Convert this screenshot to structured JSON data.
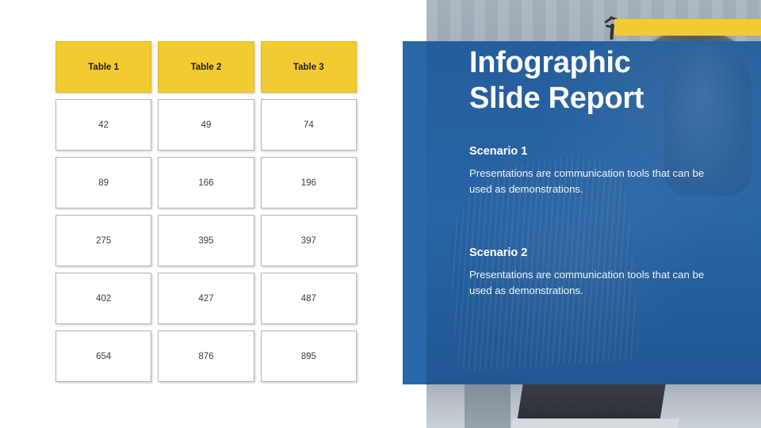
{
  "slide": {
    "background_color": "#ffffff",
    "accent_yellow": "#f2cb30",
    "panel_blue": "#2a67a8"
  },
  "panel": {
    "title": "Infographic\nSlide Report",
    "scenarios": [
      {
        "heading": "Scenario 1",
        "body": "Presentations are communication tools that can be used as demonstrations."
      },
      {
        "heading": "Scenario 2",
        "body": "Presentations are communication tools that can be used as demonstrations."
      }
    ]
  },
  "table": {
    "headers": [
      "Table 1",
      "Table 2",
      "Table 3"
    ],
    "rows": [
      [
        "42",
        "49",
        "74"
      ],
      [
        "89",
        "166",
        "196"
      ],
      [
        "275",
        "395",
        "397"
      ],
      [
        "402",
        "427",
        "487"
      ],
      [
        "654",
        "876",
        "895"
      ]
    ]
  },
  "chart_data": {
    "type": "table",
    "title": "Infographic Slide Report",
    "categories": [
      "Table 1",
      "Table 2",
      "Table 3"
    ],
    "series": [
      {
        "name": "Table 1",
        "values": [
          42,
          89,
          275,
          402,
          654
        ]
      },
      {
        "name": "Table 2",
        "values": [
          49,
          166,
          395,
          427,
          876
        ]
      },
      {
        "name": "Table 3",
        "values": [
          74,
          196,
          397,
          487,
          895
        ]
      }
    ],
    "xlabel": "",
    "ylabel": "",
    "grid": false,
    "legend": "none"
  }
}
